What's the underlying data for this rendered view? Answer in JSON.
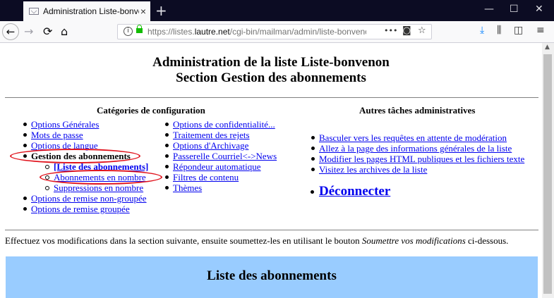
{
  "browser": {
    "tab_title": "Administration Liste-bonvenon",
    "tab_close": "×",
    "new_tab": "+",
    "url_prefix": "https://listes.",
    "url_domain": "lautre.net",
    "url_suffix": "/cgi-bin/mailman/admin/liste-bonvenon",
    "page_actions": "•••",
    "window_controls": {
      "minimize": "—",
      "maximize": "☐",
      "close": "✕"
    }
  },
  "header": {
    "title_line1": "Administration de la liste Liste-bonvenon",
    "title_line2": "Section Gestion des abonnements"
  },
  "config": {
    "heading": "Catégories de configuration",
    "left_items": [
      {
        "label": "Options Générales"
      },
      {
        "label": "Mots de passe"
      },
      {
        "label": "Options de langue"
      },
      {
        "label": "Gestion des abonnements"
      },
      {
        "label": "[Liste des abonnements]"
      },
      {
        "label": "Abonnements en nombre"
      },
      {
        "label": "Suppressions en nombre"
      },
      {
        "label": "Options de remise non-groupée"
      },
      {
        "label": "Options de remise groupée"
      }
    ],
    "right_items": [
      {
        "label": "Options de confidentialité..."
      },
      {
        "label": "Traitement des rejets"
      },
      {
        "label": "Options d'Archivage"
      },
      {
        "label": "Passerelle Courriel<->News"
      },
      {
        "label": "Répondeur automatique"
      },
      {
        "label": "Filtres de contenu"
      },
      {
        "label": "Thèmes"
      }
    ]
  },
  "other_tasks": {
    "heading": "Autres tâches administratives",
    "items": [
      {
        "label": "Basculer vers les requêtes en attente de modération"
      },
      {
        "label": "Allez à la page des informations générales de la liste"
      },
      {
        "label": "Modifier les pages HTML publiques et les fichiers texte"
      },
      {
        "label": "Visitez les archives de la liste"
      }
    ],
    "logout": "Déconnecter"
  },
  "intro": {
    "before": "Effectuez vos modifications dans la section suivante, ensuite soumettez-les en utilisant le bouton ",
    "emphasis": "Soumettre vos modifications",
    "after": " ci-dessous."
  },
  "section_panel": {
    "title": "Liste des abonnements",
    "bg": "#99ccff"
  },
  "colors": {
    "link": "#0000ee",
    "annotation": "#e0111b"
  }
}
